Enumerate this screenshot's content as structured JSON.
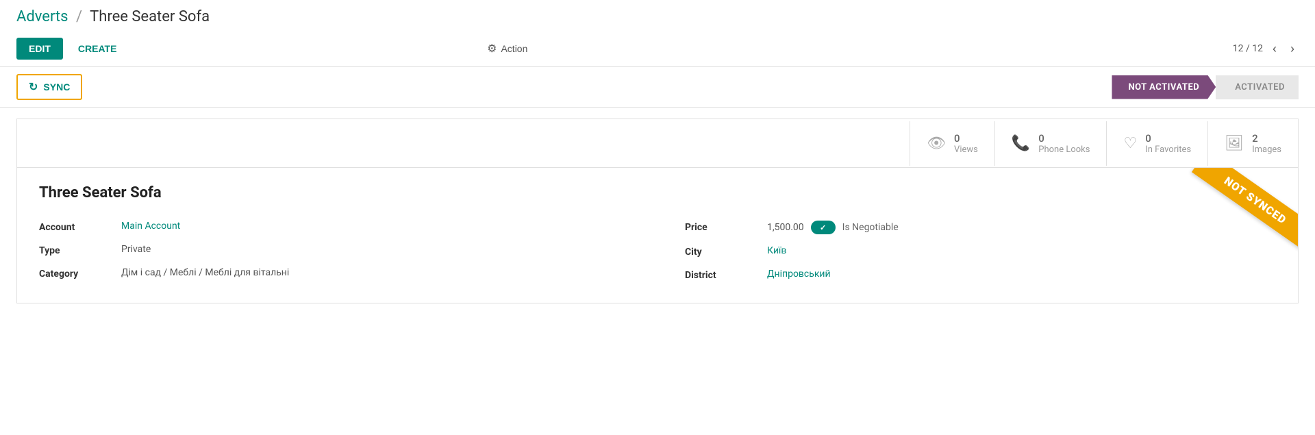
{
  "breadcrumb": {
    "parent": "Adverts",
    "separator": "/",
    "current": "Three Seater Sofa"
  },
  "toolbar": {
    "edit_label": "EDIT",
    "create_label": "CREATE",
    "action_label": "Action",
    "pagination": {
      "current": "12",
      "total": "12",
      "display": "12 / 12"
    }
  },
  "sync": {
    "label": "SYNC"
  },
  "status": {
    "not_activated": "NOT ACTIVATED",
    "activated": "ACTIVATED"
  },
  "stats": {
    "views": {
      "count": "0",
      "label": "Views"
    },
    "phone_looks": {
      "count": "0",
      "label": "Phone Looks"
    },
    "in_favorites": {
      "count": "0",
      "label": "In Favorites"
    },
    "images": {
      "count": "2",
      "label": "Images"
    }
  },
  "record": {
    "title": "Three Seater Sofa",
    "account_label": "Account",
    "account_value": "Main Account",
    "type_label": "Type",
    "type_value": "Private",
    "category_label": "Category",
    "category_value": "Дім і сад / Меблі / Меблі для вітальні",
    "price_label": "Price",
    "price_value": "1,500.00",
    "is_negotiable_label": "Is Negotiable",
    "city_label": "City",
    "city_value": "Київ",
    "district_label": "District",
    "district_value": "Дніпровський"
  },
  "ribbon": {
    "text": "NOT SYNCED"
  },
  "colors": {
    "teal": "#00897b",
    "purple": "#7b4a7b",
    "orange": "#f0a500"
  }
}
